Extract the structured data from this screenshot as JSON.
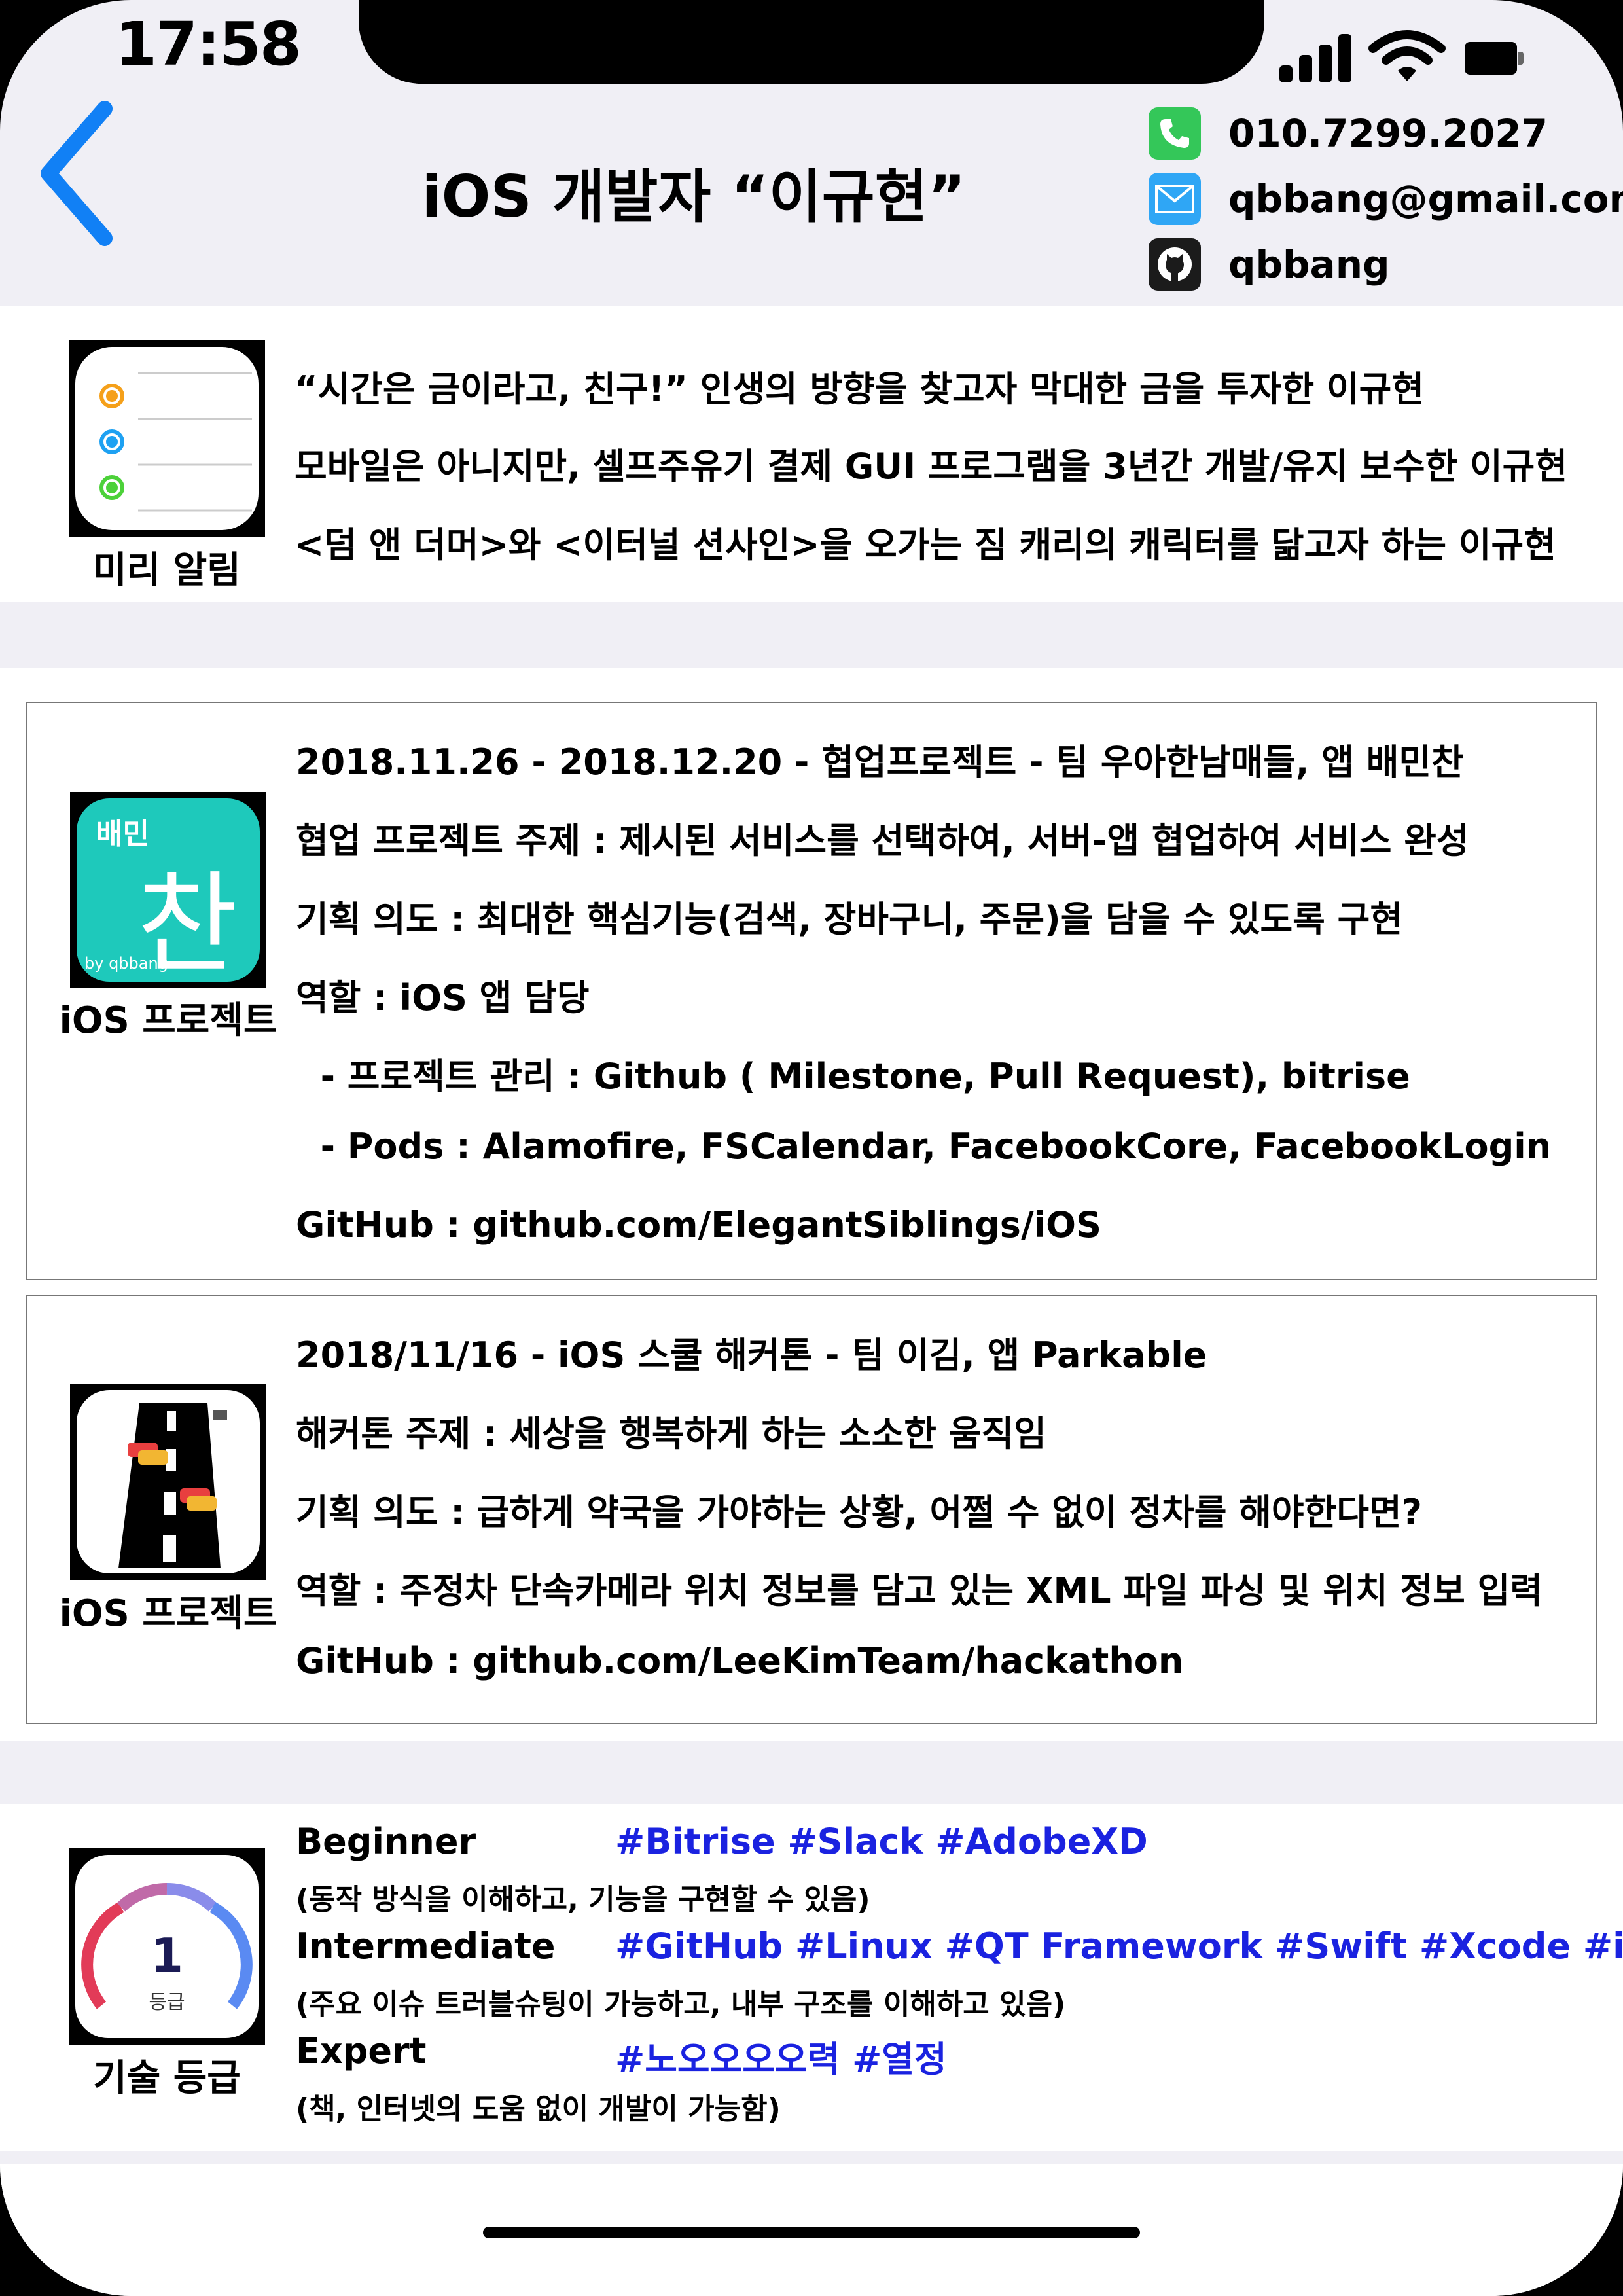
{
  "status_bar": {
    "time": "17:58"
  },
  "header": {
    "title": "iOS 개발자 “이규현”",
    "contacts": [
      {
        "icon": "phone-icon",
        "text": "010.7299.2027",
        "color": "#34c759"
      },
      {
        "icon": "mail-icon",
        "text": "qbbang@gmail.com",
        "color": "#2fa6f5"
      },
      {
        "icon": "github-icon",
        "text": "qbbang",
        "color": "#1b1b1b"
      }
    ]
  },
  "intro": {
    "icon_caption": "미리 알림",
    "lines": [
      "“시간은 금이라고, 친구!” 인생의 방향을 찾고자 막대한 금을 투자한 이규현",
      "모바일은 아니지만, 셀프주유기 결제 GUI 프로그램을 3년간 개발/유지 보수한 이규현",
      "<덤 앤 더머>와 <이터널 션사인>을 오가는 짐 캐리의 캐릭터를 닮고자 하는 이규현"
    ]
  },
  "projects": [
    {
      "icon_caption": "iOS 프로젝트",
      "icon_text_top": "배민",
      "icon_text_big": "찬",
      "icon_text_small": "by qbbang",
      "lines": [
        "2018.11.26 - 2018.12.20  - 협업프로젝트 - 팀 우아한남매들, 앱 배민찬",
        "협업 프로젝트 주제 : 제시된 서비스를 선택하여, 서버-앱 협업하여 서비스 완성",
        "기획 의도 : 최대한 핵심기능(검색, 장바구니, 주문)을 담을 수 있도록 구현",
        "역할 : iOS 앱 담당",
        "  - 프로젝트 관리 : Github ( Milestone, Pull Request), bitrise",
        "  - Pods : Alamofire, FSCalendar, FacebookCore, FacebookLogin",
        "GitHub : github.com/ElegantSiblings/iOS"
      ]
    },
    {
      "icon_caption": "iOS 프로젝트",
      "lines": [
        "2018/11/16 - iOS 스쿨 해커톤 - 팀 이김, 앱 Parkable",
        "해커톤 주제 : 세상을 행복하게 하는 소소한 움직임",
        "기획 의도 : 급하게 약국을 가야하는 상황, 어쩔 수 없이 정차를 해야한다면?",
        "역할 : 주정차 단속카메라 위치 정보를 담고 있는 XML 파일 파싱 및 위치 정보 입력",
        "GitHub : github.com/LeeKimTeam/hackathon"
      ]
    }
  ],
  "skills": {
    "icon_caption": "기술 등급",
    "gauge_number": "1",
    "gauge_label": "등급",
    "levels": [
      {
        "name": "Beginner",
        "tags": "#Bitrise #Slack #AdobeXD",
        "desc": "(동작 방식을 이해하고, 기능을 구현할 수 있음)"
      },
      {
        "name": "Intermediate",
        "tags": "#GitHub #Linux #QT Framework #Swift #Xcode #iOS",
        "desc": "(주요 이슈 트러블슈팅이 가능하고, 내부 구조를 이해하고 있음)"
      },
      {
        "name": "Expert",
        "tags": "#노오오오오력 #열정",
        "desc": "(책, 인터넷의 도움 없이 개발이 가능함)"
      }
    ],
    "tag_color": "#1a22e0"
  }
}
